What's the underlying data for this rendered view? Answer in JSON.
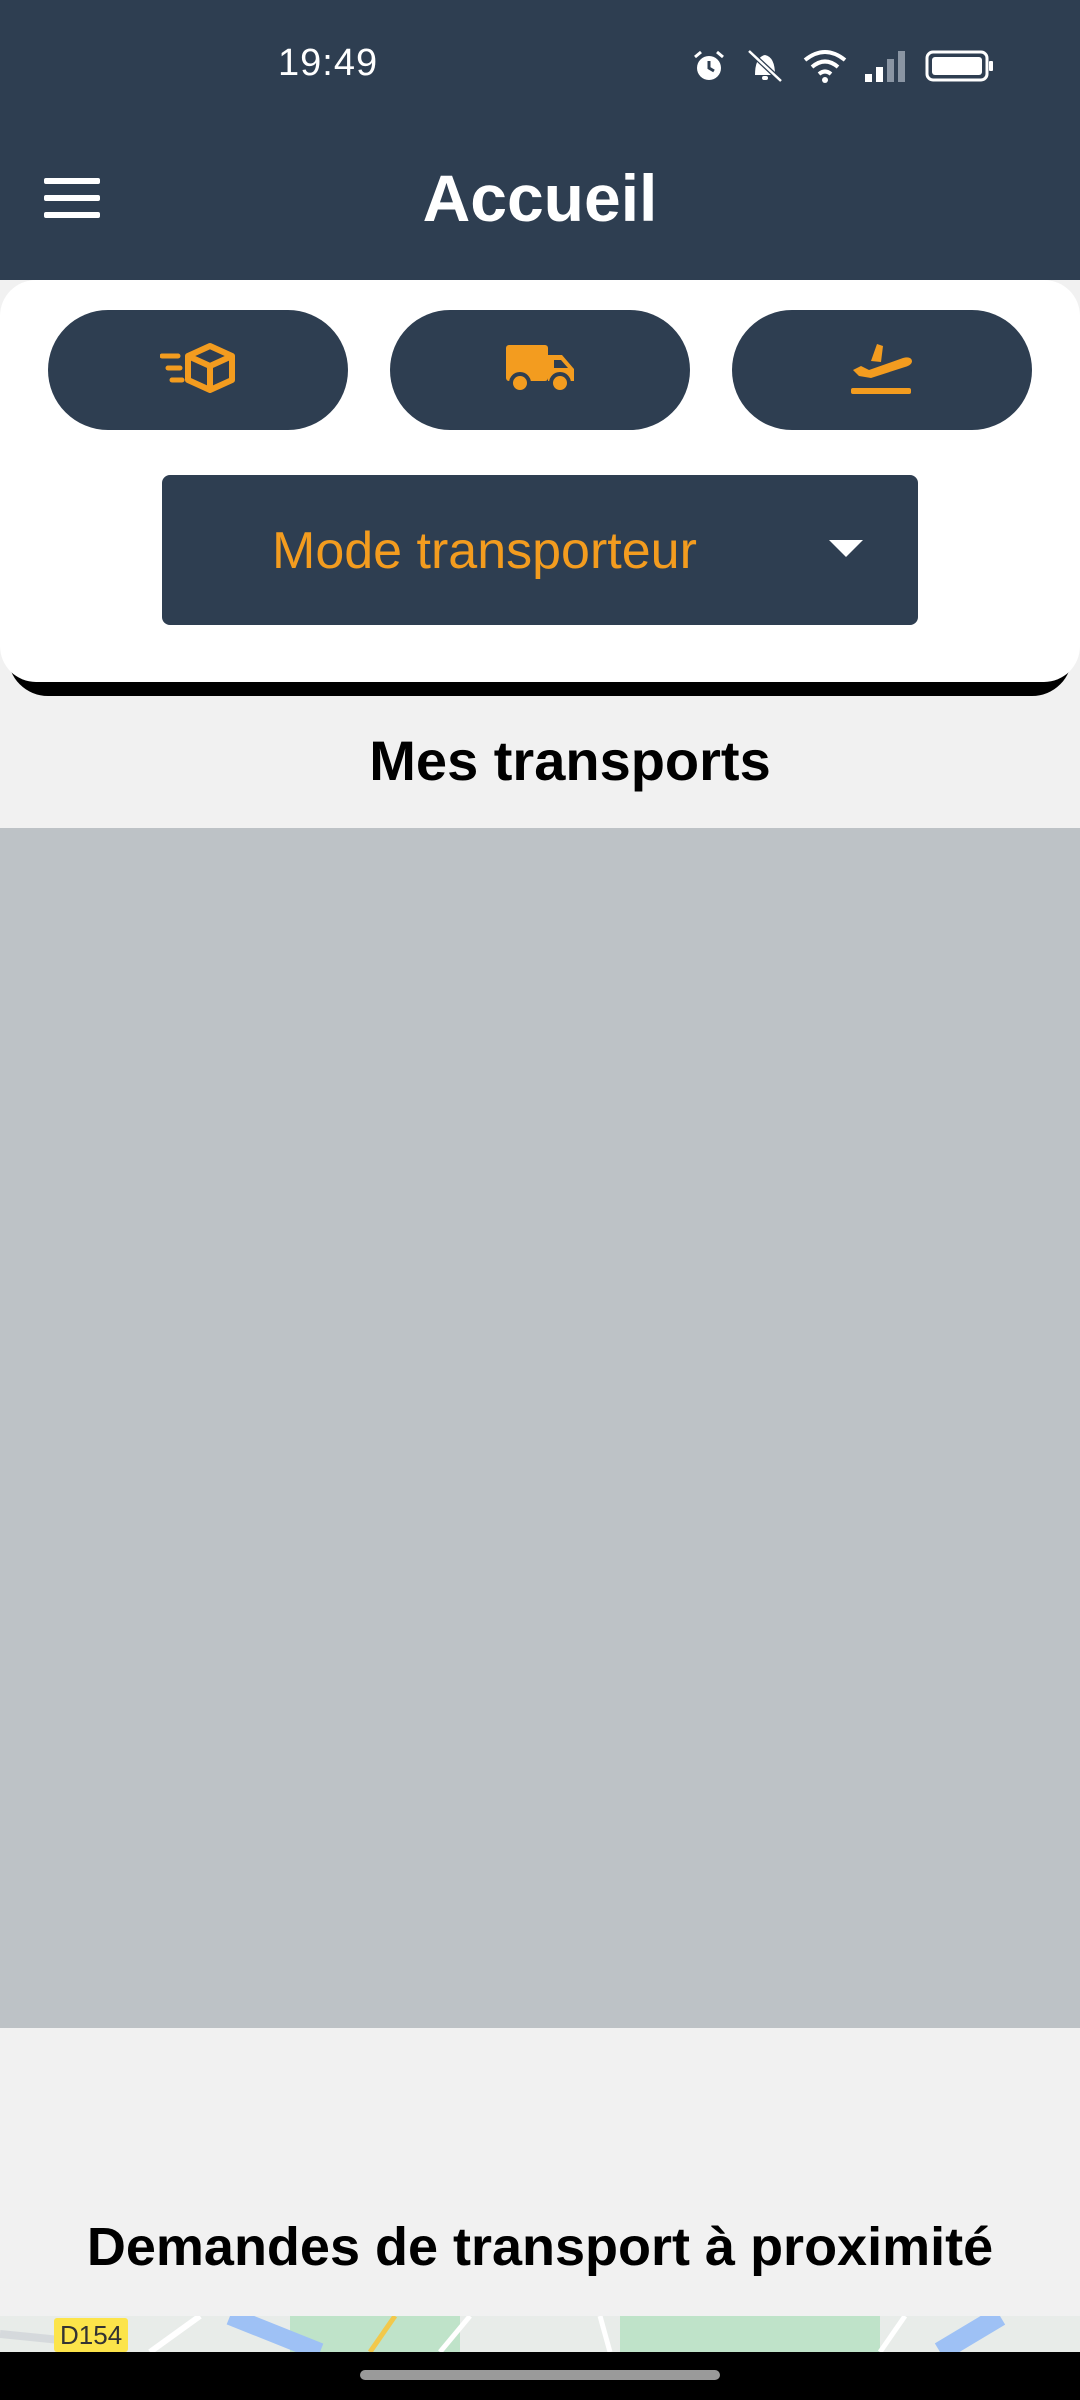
{
  "status_bar": {
    "time": "19:49",
    "icons": [
      "alarm-icon",
      "bell-muted-icon",
      "wifi-icon",
      "signal-icon",
      "battery-icon"
    ]
  },
  "app_bar": {
    "title": "Accueil",
    "menu_icon": "menu-icon"
  },
  "quick_actions": [
    {
      "icon": "fast-package-icon"
    },
    {
      "icon": "truck-icon"
    },
    {
      "icon": "plane-departure-icon"
    }
  ],
  "mode_selector": {
    "selected": "Mode transporteur",
    "icon": "caret-down-icon"
  },
  "sections": {
    "my_transports_title": "Mes transports",
    "nearby_requests_title": "Demandes de transport à proximité"
  },
  "map": {
    "road_label": "D154"
  },
  "colors": {
    "primary": "#2e3e51",
    "accent": "#f39c1f",
    "background": "#f1f1f1",
    "placeholder": "#bdc2c6"
  }
}
